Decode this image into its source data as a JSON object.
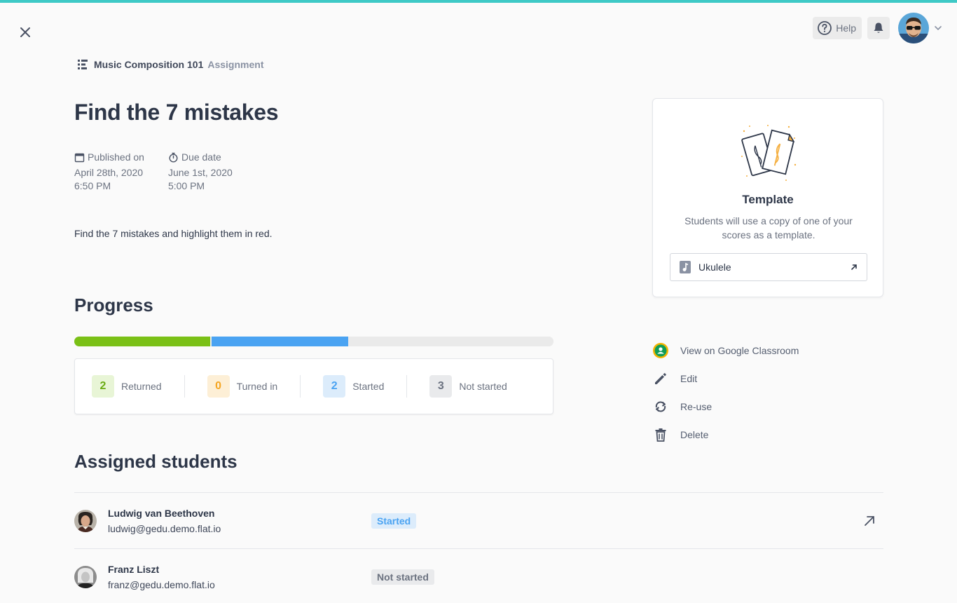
{
  "colors": {
    "accent": "#3ec9c6",
    "returned": "#7ac016",
    "turned_in": "#f5a623",
    "started": "#4aa3f2",
    "not_started": "#6b7280"
  },
  "header": {
    "help_label": "Help",
    "close_icon": "close-icon",
    "bell_icon": "bell-icon"
  },
  "breadcrumb": {
    "course": "Music Composition 101",
    "kind": "Assignment"
  },
  "assignment": {
    "title": "Find the 7 mistakes",
    "published_label": "Published on",
    "published_date": "April 28th, 2020",
    "published_time": "6:50 PM",
    "due_label": "Due date",
    "due_date": "June 1st, 2020",
    "due_time": "5:00 PM",
    "description": "Find the 7 mistakes and highlight them in red."
  },
  "progress": {
    "title": "Progress",
    "fractions": {
      "returned": 0.286,
      "started": 0.286,
      "not_started": 0.428
    },
    "stats": [
      {
        "count": "2",
        "label": "Returned"
      },
      {
        "count": "0",
        "label": "Turned in"
      },
      {
        "count": "2",
        "label": "Started"
      },
      {
        "count": "3",
        "label": "Not started"
      }
    ]
  },
  "template": {
    "title": "Template",
    "description": "Students will use a copy of one of your scores as a template.",
    "score_name": "Ukulele"
  },
  "actions": [
    {
      "label": "View on Google Classroom",
      "icon": "google-classroom-icon"
    },
    {
      "label": "Edit",
      "icon": "pencil-icon"
    },
    {
      "label": "Re-use",
      "icon": "refresh-icon"
    },
    {
      "label": "Delete",
      "icon": "trash-icon"
    }
  ],
  "students": {
    "title": "Assigned students",
    "rows": [
      {
        "name": "Ludwig van Beethoven",
        "email": "ludwig@gedu.demo.flat.io",
        "status": "Started"
      },
      {
        "name": "Franz Liszt",
        "email": "franz@gedu.demo.flat.io",
        "status": "Not started"
      }
    ]
  }
}
